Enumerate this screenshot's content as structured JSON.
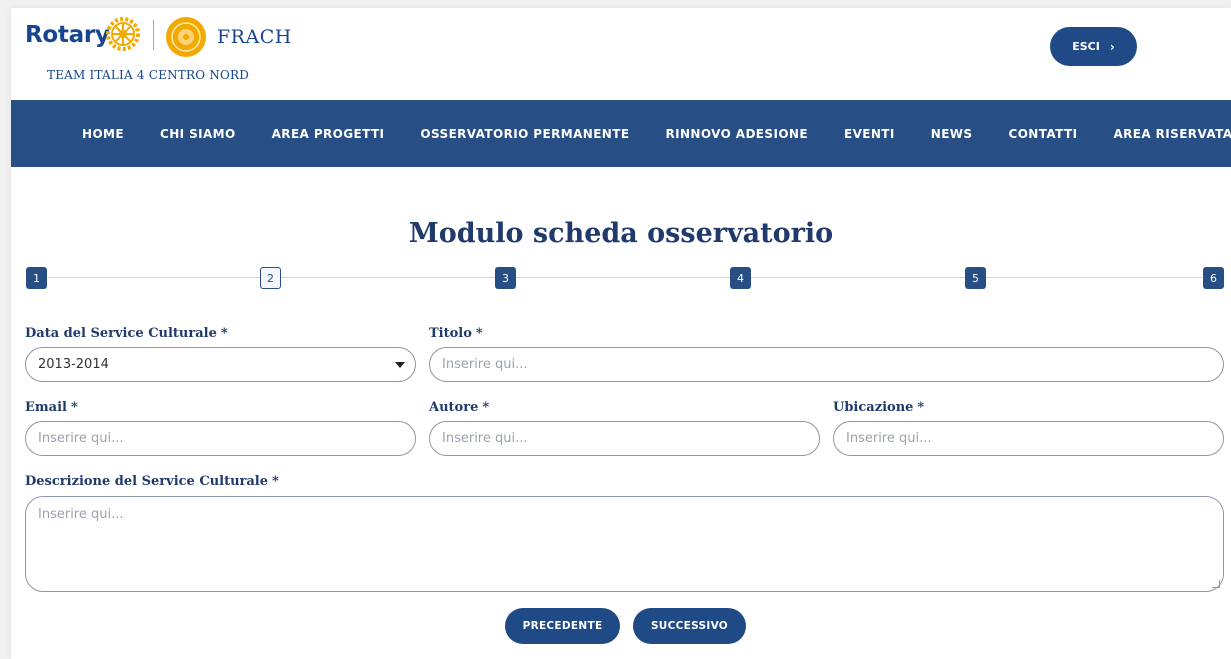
{
  "brand": {
    "rotary": "Rotary",
    "frach": "FRACH",
    "team": "TEAM ITALIA 4 CENTRO NORD",
    "color": "#17458f",
    "gold": "#f2a900"
  },
  "header": {
    "exit_label": "ESCI"
  },
  "nav": {
    "items": [
      "HOME",
      "CHI SIAMO",
      "AREA PROGETTI",
      "OSSERVATORIO PERMANENTE",
      "RINNOVO ADESIONE",
      "EVENTI",
      "NEWS",
      "CONTATTI",
      "AREA RISERVATA"
    ],
    "background": "#284e86"
  },
  "page_title": "Modulo scheda osservatorio",
  "stepper": {
    "steps": [
      "1",
      "2",
      "3",
      "4",
      "5",
      "6"
    ],
    "active": "2"
  },
  "form": {
    "data_label": "Data del Service Culturale",
    "data_value": "2013-2014",
    "titolo_label": "Titolo",
    "email_label": "Email",
    "autore_label": "Autore",
    "ubicazione_label": "Ubicazione",
    "descrizione_label": "Descrizione del Service Culturale",
    "required_mark": "*",
    "placeholder": "Inserire qui..."
  },
  "buttons": {
    "prev": "PRECEDENTE",
    "next": "SUCCESSIVO"
  }
}
